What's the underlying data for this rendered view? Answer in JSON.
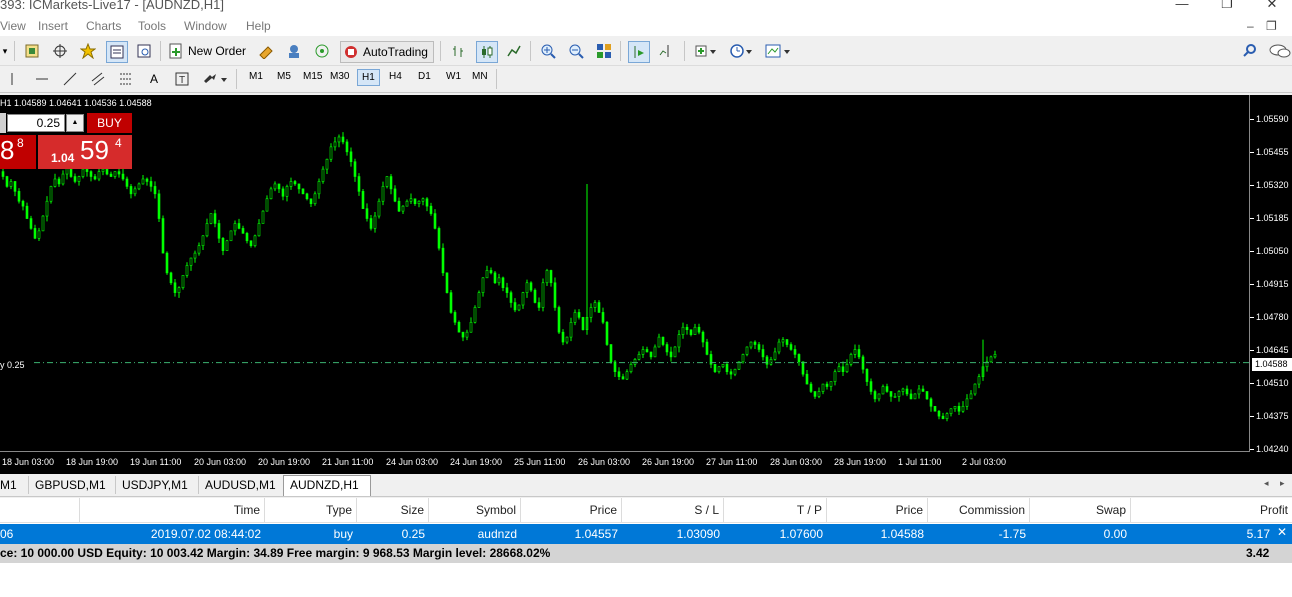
{
  "window": {
    "title": "393: ICMarkets-Live17 - [AUDNZD,H1]",
    "controls": [
      "—",
      "❐",
      "✕"
    ],
    "child_controls": [
      "–",
      "❐"
    ]
  },
  "menu": [
    "View",
    "Insert",
    "Charts",
    "Tools",
    "Window",
    "Help"
  ],
  "toolbar": {
    "new_order": "New Order",
    "auto_trading": "AutoTrading"
  },
  "timeframes": [
    "M1",
    "M5",
    "M15",
    "M30",
    "H1",
    "H4",
    "D1",
    "W1",
    "MN"
  ],
  "timeframe_active": "H1",
  "chart": {
    "ohlc_text": "H1  1.04589 1.04641 1.04536 1.04588",
    "trade_line_label": "y 0.25",
    "current_price": "1.04588",
    "price_labels": [
      "1.05590",
      "1.05455",
      "1.05320",
      "1.05185",
      "1.05050",
      "1.04915",
      "1.04780",
      "1.04645",
      "1.04510",
      "1.04375",
      "1.04240"
    ],
    "time_labels": [
      "18 Jun 03:00",
      "18 Jun 19:00",
      "19 Jun 11:00",
      "20 Jun 03:00",
      "20 Jun 19:00",
      "21 Jun 11:00",
      "24 Jun 03:00",
      "24 Jun 19:00",
      "25 Jun 11:00",
      "26 Jun 03:00",
      "26 Jun 19:00",
      "27 Jun 11:00",
      "28 Jun 03:00",
      "28 Jun 19:00",
      "1 Jul 11:00",
      "2 Jul 03:00"
    ],
    "price_series": [
      1.0533,
      1.0531,
      1.0527,
      1.0529,
      1.0525,
      1.0521,
      1.0519,
      1.0514,
      1.051,
      1.0506,
      1.0509,
      1.0515,
      1.0521,
      1.0527,
      1.053,
      1.0528,
      1.0532,
      1.0535,
      1.0531,
      1.0529,
      1.0531,
      1.0534,
      1.0533,
      1.0531,
      1.053,
      1.0533,
      1.0534,
      1.0532,
      1.0531,
      1.0533,
      1.0532,
      1.053,
      1.0527,
      1.0524,
      1.0526,
      1.0528,
      1.053,
      1.0529,
      1.0527,
      1.0524,
      1.0514,
      1.05,
      1.0492,
      1.0488,
      1.0484,
      1.0486,
      1.0491,
      1.0495,
      1.0498,
      1.05,
      1.0503,
      1.0507,
      1.0512,
      1.0516,
      1.0512,
      1.0506,
      1.0501,
      1.0505,
      1.0509,
      1.0512,
      1.051,
      1.0508,
      1.0505,
      1.0503,
      1.0507,
      1.0512,
      1.0517,
      1.0522,
      1.0526,
      1.0528,
      1.0526,
      1.0523,
      1.0527,
      1.0529,
      1.0528,
      1.0526,
      1.0524,
      1.0522,
      1.052,
      1.0524,
      1.0529,
      1.0534,
      1.0538,
      1.0543,
      1.0545,
      1.0547,
      1.0545,
      1.0541,
      1.0537,
      1.0531,
      1.0525,
      1.0518,
      1.0514,
      1.051,
      1.0515,
      1.0521,
      1.0527,
      1.0531,
      1.0526,
      1.0521,
      1.0517,
      1.0519,
      1.0521,
      1.0522,
      1.052,
      1.0521,
      1.0522,
      1.0519,
      1.0516,
      1.051,
      1.0502,
      1.0492,
      1.0484,
      1.0476,
      1.0472,
      1.0468,
      1.0466,
      1.0468,
      1.0472,
      1.0478,
      1.0484,
      1.049,
      1.0493,
      1.0492,
      1.0488,
      1.049,
      1.0486,
      1.0484,
      1.048,
      1.0477,
      1.0479,
      1.0484,
      1.0488,
      1.0485,
      1.048,
      1.0478,
      1.0488,
      1.0493,
      1.0488,
      1.0478,
      1.0468,
      1.0464,
      1.0466,
      1.0472,
      1.0476,
      1.0474,
      1.0469,
      1.0474,
      1.0478,
      1.048,
      1.0476,
      1.0472,
      1.0463,
      1.0456,
      1.0452,
      1.045,
      1.0449,
      1.0452,
      1.0455,
      1.0457,
      1.0459,
      1.0461,
      1.046,
      1.0458,
      1.0462,
      1.0466,
      1.0463,
      1.046,
      1.0458,
      1.0462,
      1.0467,
      1.047,
      1.0469,
      1.0467,
      1.047,
      1.0468,
      1.0464,
      1.0459,
      1.0455,
      1.0452,
      1.0454,
      1.0455,
      1.0452,
      1.0451,
      1.0453,
      1.0456,
      1.0459,
      1.0462,
      1.0464,
      1.0463,
      1.0461,
      1.0458,
      1.0455,
      1.0457,
      1.046,
      1.0464,
      1.0465,
      1.0463,
      1.0461,
      1.0459,
      1.0456,
      1.0451,
      1.0447,
      1.0444,
      1.0442,
      1.0444,
      1.0447,
      1.0446,
      1.0448,
      1.0452,
      1.0454,
      1.0452,
      1.0455,
      1.0459,
      1.0461,
      1.0458,
      1.0453,
      1.0448,
      1.0444,
      1.0441,
      1.0443,
      1.0446,
      1.0444,
      1.0442,
      1.0442,
      1.0444,
      1.0445,
      1.0443,
      1.0441,
      1.0443,
      1.0445,
      1.0444,
      1.0441,
      1.0438,
      1.0436,
      1.0434,
      1.0433,
      1.0435,
      1.0437,
      1.0438,
      1.0436,
      1.0438,
      1.0441,
      1.0443,
      1.0447,
      1.045,
      1.0454,
      1.0456,
      1.0458,
      1.0459
    ],
    "price_range": [
      1.04195,
      1.0564
    ]
  },
  "one_click": {
    "lot": "0.25",
    "buy_label": "BUY",
    "sell_big": "8",
    "sell_sup": "8",
    "buy_prefix": "1.04",
    "buy_big": "59",
    "buy_sup": "4"
  },
  "symbol_tabs": [
    "M1",
    "GBPUSD,M1",
    "USDJPY,M1",
    "AUDUSD,M1",
    "AUDNZD,H1"
  ],
  "terminal": {
    "headers": [
      "Time",
      "Type",
      "Size",
      "Symbol",
      "Price",
      "S / L",
      "T / P",
      "Price",
      "Commission",
      "Swap",
      "Profit"
    ],
    "row": [
      "06",
      "2019.07.02 08:44:02",
      "buy",
      "0.25",
      "audnzd",
      "1.04557",
      "1.03090",
      "1.07600",
      "1.04588",
      "-1.75",
      "0.00",
      "5.17"
    ],
    "summary": "ce: 10 000.00 USD  Equity: 10 003.42  Margin: 34.89  Free margin: 9 968.53  Margin level: 28668.02%",
    "summary_total": "3.42"
  },
  "colors": {
    "candle": "#00ff00",
    "chart_bg": "#000000",
    "trade_line": "#3cb371",
    "sell_panel": "#c00000",
    "buy_panel": "#d62b2b",
    "row_selected": "#0078d7"
  }
}
